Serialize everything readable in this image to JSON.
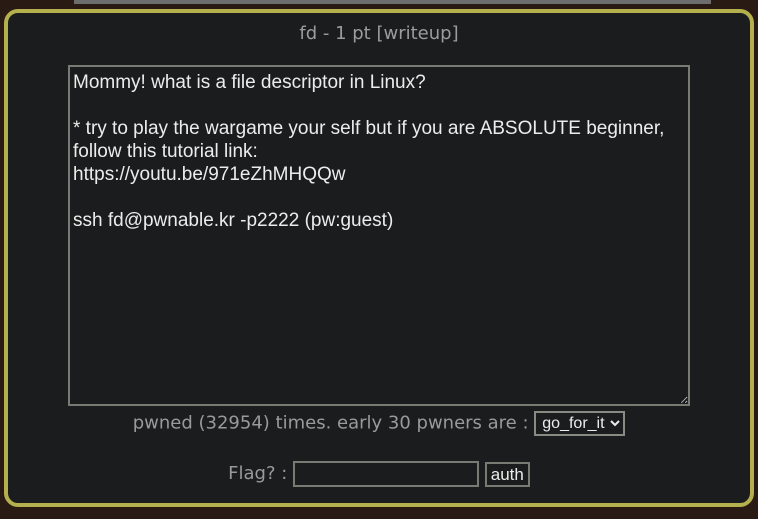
{
  "challenge": {
    "title": "fd - 1 pt",
    "writeup_link": "[writeup]",
    "description": "Mommy! what is a file descriptor in Linux?\n\n* try to play the wargame your self but if you are ABSOLUTE beginner, follow this tutorial link:\nhttps://youtu.be/971eZhMHQQw\n\nssh fd@pwnable.kr -p2222 (pw:guest)",
    "pwned_prefix": "pwned (32954) times. early 30 pwners are :",
    "pwners_selected": "go_for_it",
    "flag_label": "Flag? :",
    "flag_value": "",
    "auth_label": "auth"
  }
}
